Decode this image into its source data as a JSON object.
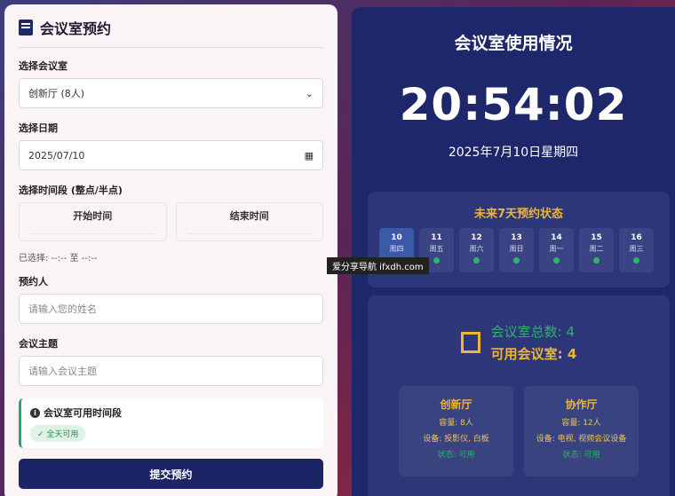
{
  "form": {
    "title": "会议室预约",
    "room_label": "选择会议室",
    "room_value": "创新厅 (8人)",
    "date_label": "选择日期",
    "date_value": "2025/07/10",
    "time_label": "选择时间段 (整点/半点)",
    "start_label": "开始时间",
    "end_label": "结束时间",
    "selected_text": "已选择: --:-- 至 --:--",
    "person_label": "预约人",
    "person_placeholder": "请输入您的姓名",
    "topic_label": "会议主题",
    "topic_placeholder": "请输入会议主题",
    "avail_title": "会议室可用时间段",
    "avail_badge": "✓ 全天可用",
    "submit_label": "提交预约"
  },
  "status": {
    "title": "会议室使用情况",
    "clock": "20:54:02",
    "date": "2025年7月10日星期四",
    "week_title": "未来7天预约状态",
    "days": [
      {
        "d": "10",
        "w": "周四"
      },
      {
        "d": "11",
        "w": "周五"
      },
      {
        "d": "12",
        "w": "周六"
      },
      {
        "d": "13",
        "w": "周日"
      },
      {
        "d": "14",
        "w": "周一"
      },
      {
        "d": "15",
        "w": "周二"
      },
      {
        "d": "16",
        "w": "周三"
      }
    ],
    "total": "会议室总数: 4",
    "available": "可用会议室: 4",
    "rooms": [
      {
        "name": "创新厅",
        "cap": "容量: 8人",
        "equip": "设备: 投影仪, 白板",
        "state": "状态: 可用"
      },
      {
        "name": "协作厅",
        "cap": "容量: 12人",
        "equip": "设备: 电视, 视频会议设备",
        "state": "状态: 可用"
      }
    ]
  },
  "watermark": "爱分享导航 ifxdh.com"
}
